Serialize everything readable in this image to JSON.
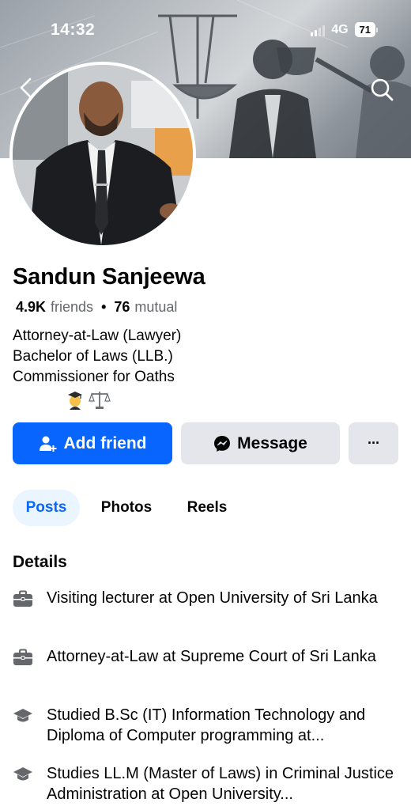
{
  "status_bar": {
    "time": "14:32",
    "network": "4G",
    "battery": "71"
  },
  "profile": {
    "name": "Sandun Sanjeewa",
    "friends_count": "4.9K",
    "friends_label": "friends",
    "separator": "•",
    "mutual_count": "76",
    "mutual_label": "mutual",
    "bio_lines": [
      "Attorney-at-Law (Lawyer)",
      "Bachelor of Laws (LLB.)",
      "Commissioner for Oaths"
    ],
    "bio_emojis": [
      "graduate-emoji",
      "scales-emoji"
    ]
  },
  "actions": {
    "add_friend": "Add friend",
    "message": "Message",
    "more": "···"
  },
  "tabs": [
    {
      "label": "Posts",
      "active": true
    },
    {
      "label": "Photos",
      "active": false
    },
    {
      "label": "Reels",
      "active": false
    }
  ],
  "details": {
    "title": "Details",
    "items": [
      {
        "icon": "briefcase-icon",
        "text": "Visiting lecturer at Open University of Sri Lanka"
      },
      {
        "icon": "briefcase-icon",
        "text": "Attorney-at-Law at Supreme Court of Sri Lanka"
      },
      {
        "icon": "graduation-cap-icon",
        "text": "Studied B.Sc (IT) Information Technology and Diploma of Computer programming at..."
      },
      {
        "icon": "graduation-cap-icon",
        "text": "Studies LL.M (Master of Laws) in Criminal Justice Administration at Open University..."
      }
    ]
  },
  "colors": {
    "primary": "#0866ff",
    "secondary_button": "#e4e6eb",
    "active_tab_bg": "#ebf5ff",
    "muted_text": "#65676b"
  }
}
